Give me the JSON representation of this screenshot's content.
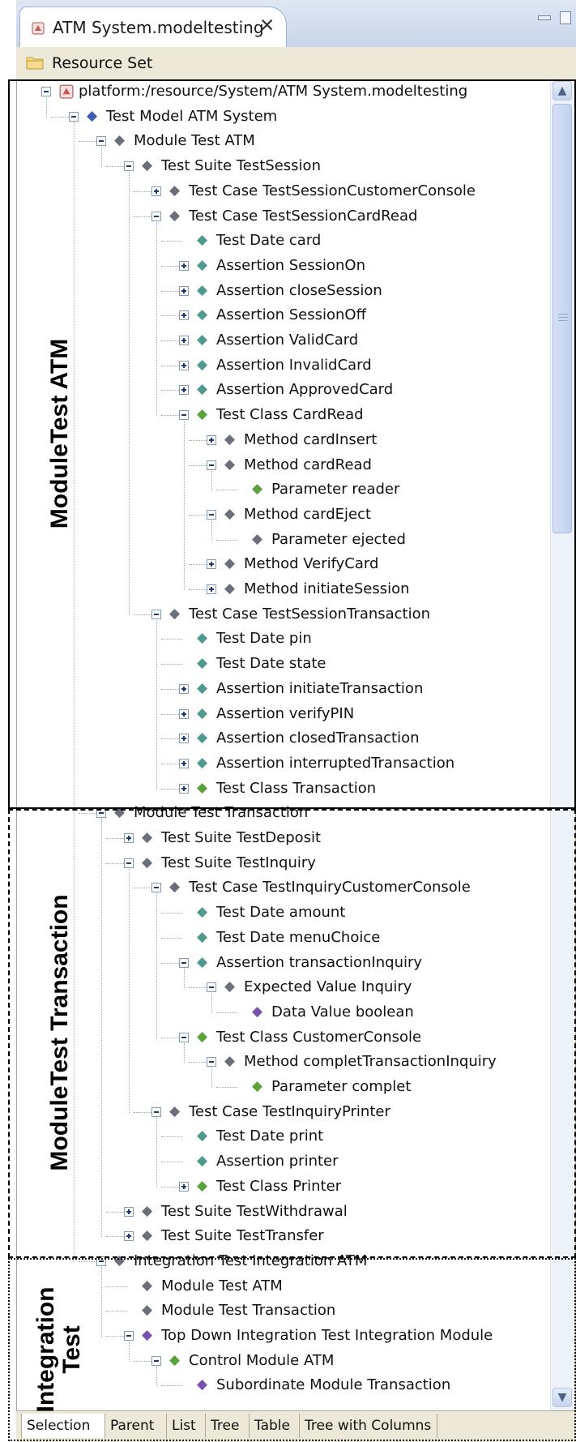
{
  "editor_tab": {
    "title": "ATM System.modeltesting",
    "close_glyph": "✕"
  },
  "resource_set": {
    "label": "Resource Set"
  },
  "tree": [
    {
      "label": "platform:/resource/System/ATM System.modeltesting",
      "depth": 0,
      "expander": "minus",
      "icon": "resource-file-icon"
    },
    {
      "label": "Test Model ATM System",
      "depth": 1,
      "expander": "minus",
      "icon": "blue-diamond"
    },
    {
      "label": "Module Test ATM",
      "depth": 2,
      "expander": "minus",
      "icon": "gray-diamond"
    },
    {
      "label": "Test Suite TestSession",
      "depth": 3,
      "expander": "minus",
      "icon": "gray-diamond"
    },
    {
      "label": "Test Case TestSessionCustomerConsole",
      "depth": 4,
      "expander": "plus",
      "icon": "gray-diamond"
    },
    {
      "label": "Test Case TestSessionCardRead",
      "depth": 4,
      "expander": "minus",
      "icon": "gray-diamond"
    },
    {
      "label": "Test Date card",
      "depth": 5,
      "expander": "none",
      "icon": "teal-diamond"
    },
    {
      "label": "Assertion SessionOn",
      "depth": 5,
      "expander": "plus",
      "icon": "teal-diamond"
    },
    {
      "label": "Assertion closeSession",
      "depth": 5,
      "expander": "plus",
      "icon": "teal-diamond"
    },
    {
      "label": "Assertion SessionOff",
      "depth": 5,
      "expander": "plus",
      "icon": "teal-diamond"
    },
    {
      "label": "Assertion ValidCard",
      "depth": 5,
      "expander": "plus",
      "icon": "teal-diamond"
    },
    {
      "label": "Assertion InvalidCard",
      "depth": 5,
      "expander": "plus",
      "icon": "teal-diamond"
    },
    {
      "label": "Assertion ApprovedCard",
      "depth": 5,
      "expander": "plus",
      "icon": "teal-diamond"
    },
    {
      "label": "Test Class CardRead",
      "depth": 5,
      "expander": "minus",
      "icon": "green-diamond"
    },
    {
      "label": "Method cardInsert",
      "depth": 6,
      "expander": "plus",
      "icon": "gray-diamond"
    },
    {
      "label": "Method cardRead",
      "depth": 6,
      "expander": "minus",
      "icon": "gray-diamond"
    },
    {
      "label": "Parameter reader",
      "depth": 7,
      "expander": "none",
      "icon": "green-diamond"
    },
    {
      "label": "Method cardEject",
      "depth": 6,
      "expander": "minus",
      "icon": "gray-diamond"
    },
    {
      "label": "Parameter ejected",
      "depth": 7,
      "expander": "none",
      "icon": "gray-diamond"
    },
    {
      "label": "Method VerifyCard",
      "depth": 6,
      "expander": "plus",
      "icon": "gray-diamond"
    },
    {
      "label": "Method initiateSession",
      "depth": 6,
      "expander": "plus",
      "icon": "gray-diamond"
    },
    {
      "label": "Test Case TestSessionTransaction",
      "depth": 4,
      "expander": "minus",
      "icon": "gray-diamond"
    },
    {
      "label": "Test Date pin",
      "depth": 5,
      "expander": "none",
      "icon": "teal-diamond"
    },
    {
      "label": "Test Date state",
      "depth": 5,
      "expander": "none",
      "icon": "teal-diamond"
    },
    {
      "label": "Assertion initiateTransaction",
      "depth": 5,
      "expander": "plus",
      "icon": "teal-diamond"
    },
    {
      "label": "Assertion verifyPIN",
      "depth": 5,
      "expander": "plus",
      "icon": "teal-diamond"
    },
    {
      "label": "Assertion closedTransaction",
      "depth": 5,
      "expander": "plus",
      "icon": "teal-diamond"
    },
    {
      "label": "Assertion interruptedTransaction",
      "depth": 5,
      "expander": "plus",
      "icon": "teal-diamond"
    },
    {
      "label": "Test Class Transaction",
      "depth": 5,
      "expander": "plus",
      "icon": "green-diamond"
    },
    {
      "label": "Module Test Transaction",
      "depth": 2,
      "expander": "minus",
      "icon": "gray-diamond"
    },
    {
      "label": "Test Suite TestDeposit",
      "depth": 3,
      "expander": "plus",
      "icon": "gray-diamond"
    },
    {
      "label": "Test Suite TestInquiry",
      "depth": 3,
      "expander": "minus",
      "icon": "gray-diamond"
    },
    {
      "label": "Test Case TestInquiryCustomerConsole",
      "depth": 4,
      "expander": "minus",
      "icon": "gray-diamond"
    },
    {
      "label": "Test Date amount",
      "depth": 5,
      "expander": "none",
      "icon": "teal-diamond"
    },
    {
      "label": "Test Date menuChoice",
      "depth": 5,
      "expander": "none",
      "icon": "teal-diamond"
    },
    {
      "label": "Assertion transactionInquiry",
      "depth": 5,
      "expander": "minus",
      "icon": "teal-diamond"
    },
    {
      "label": "Expected Value Inquiry",
      "depth": 6,
      "expander": "minus",
      "icon": "gray-diamond"
    },
    {
      "label": "Data Value boolean",
      "depth": 7,
      "expander": "none",
      "icon": "purple-diamond"
    },
    {
      "label": "Test Class CustomerConsole",
      "depth": 5,
      "expander": "minus",
      "icon": "green-diamond"
    },
    {
      "label": "Method completTransactionInquiry",
      "depth": 6,
      "expander": "minus",
      "icon": "gray-diamond"
    },
    {
      "label": "Parameter complet",
      "depth": 7,
      "expander": "none",
      "icon": "green-diamond"
    },
    {
      "label": "Test Case TestInquiryPrinter",
      "depth": 4,
      "expander": "minus",
      "icon": "gray-diamond"
    },
    {
      "label": "Test Date print",
      "depth": 5,
      "expander": "none",
      "icon": "teal-diamond"
    },
    {
      "label": "Assertion printer",
      "depth": 5,
      "expander": "none",
      "icon": "teal-diamond"
    },
    {
      "label": "Test Class Printer",
      "depth": 5,
      "expander": "plus",
      "icon": "green-diamond"
    },
    {
      "label": "Test Suite TestWithdrawal",
      "depth": 3,
      "expander": "plus",
      "icon": "gray-diamond"
    },
    {
      "label": "Test Suite TestTransfer",
      "depth": 3,
      "expander": "plus",
      "icon": "gray-diamond"
    },
    {
      "label": "Integration Test Integration ATM",
      "depth": 2,
      "expander": "minus",
      "icon": "gray-diamond"
    },
    {
      "label": "Module Test ATM",
      "depth": 3,
      "expander": "none",
      "icon": "gray-diamond"
    },
    {
      "label": "Module Test Transaction",
      "depth": 3,
      "expander": "none",
      "icon": "gray-diamond"
    },
    {
      "label": "Top Down Integration Test Integration Module",
      "depth": 3,
      "expander": "minus",
      "icon": "purple-diamond"
    },
    {
      "label": "Control Module ATM",
      "depth": 4,
      "expander": "minus",
      "icon": "green-diamond"
    },
    {
      "label": "Subordinate Module Transaction",
      "depth": 5,
      "expander": "none",
      "icon": "purple-diamond"
    }
  ],
  "bottom_tabs": [
    "Selection",
    "Parent",
    "List",
    "Tree",
    "Table",
    "Tree with Columns"
  ],
  "annotations": {
    "module_atm": "ModuleTest ATM",
    "module_transaction": "ModuleTest Transaction",
    "integration_line1": "Integration",
    "integration_line2": "Test"
  },
  "icon_colors": {
    "blue-diamond": "#3b5bb5",
    "gray-diamond": "#6b6f7a",
    "teal-diamond": "#4f9a8c",
    "green-diamond": "#5aa33a",
    "purple-diamond": "#7a4fb0"
  }
}
